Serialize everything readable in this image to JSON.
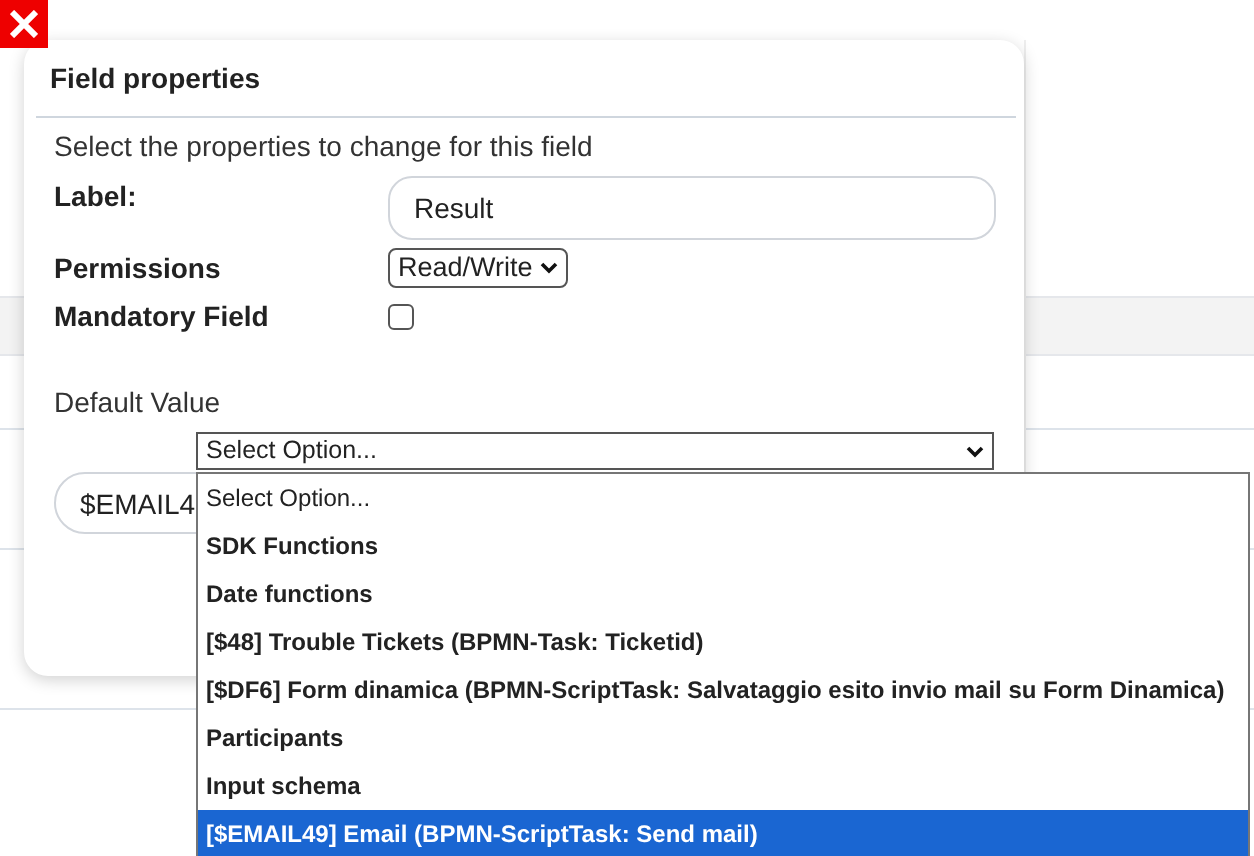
{
  "dialog": {
    "title": "Field properties",
    "subtitle": "Select the properties to change for this field",
    "fields": [
      {
        "kind": "text",
        "label": "Label:",
        "value": "Result"
      },
      {
        "kind": "select",
        "label": "Permissions",
        "value": "Read/Write"
      },
      {
        "kind": "checkbox",
        "label": "Mandatory Field",
        "checked": false
      }
    ],
    "default_value": {
      "label": "Default Value",
      "select_value": "Select Option...",
      "value": "$EMAIL4",
      "options": [
        {
          "label": "Select Option...",
          "kind": "placeholder",
          "selected": false
        },
        {
          "label": "SDK Functions",
          "kind": "group",
          "selected": false
        },
        {
          "label": "Date functions",
          "kind": "group",
          "selected": false
        },
        {
          "label": "[$48] Trouble Tickets (BPMN-Task: Ticketid)",
          "kind": "group",
          "selected": false
        },
        {
          "label": "[$DF6] Form dinamica (BPMN-ScriptTask: Salvataggio esito invio mail su Form Dinamica)",
          "kind": "group",
          "selected": false
        },
        {
          "label": "Participants",
          "kind": "group",
          "selected": false
        },
        {
          "label": "Input schema",
          "kind": "group",
          "selected": false
        },
        {
          "label": "[$EMAIL49] Email (BPMN-ScriptTask: Send mail)",
          "kind": "group",
          "selected": true
        }
      ]
    }
  }
}
